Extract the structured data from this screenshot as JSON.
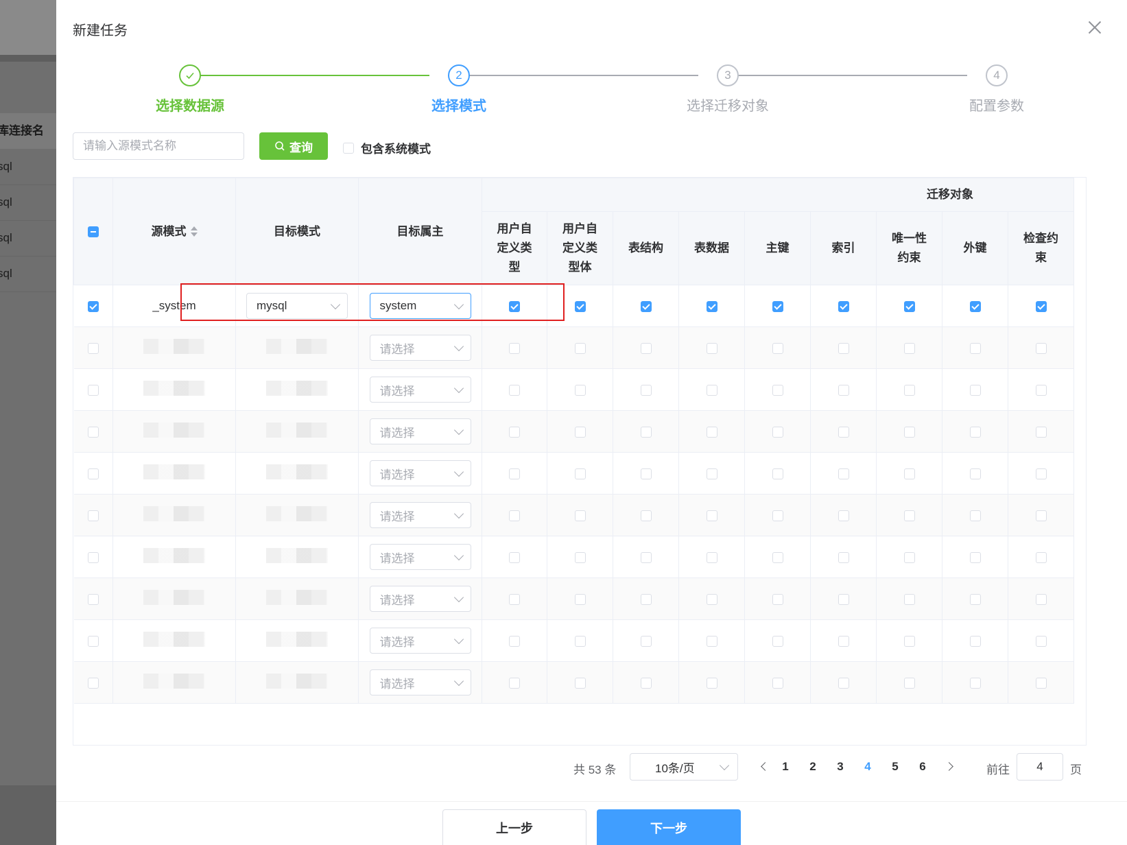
{
  "background": {
    "column_header": "库连接名",
    "rows": [
      "sql",
      "sql",
      "sql",
      "sql"
    ]
  },
  "dialog": {
    "title": "新建任务",
    "steps": [
      {
        "title": "选择数据源",
        "number": "1",
        "state": "done"
      },
      {
        "title": "选择模式",
        "number": "2",
        "state": "active"
      },
      {
        "title": "选择迁移对象",
        "number": "3",
        "state": "wait"
      },
      {
        "title": "配置参数",
        "number": "4",
        "state": "wait"
      }
    ],
    "search": {
      "placeholder": "请输入源模式名称",
      "button": "查询",
      "include_system_label": "包含系统模式"
    },
    "table": {
      "headers": {
        "source_schema": "源模式",
        "target_schema": "目标模式",
        "target_owner": "目标属主",
        "migrate_objects": "迁移对象",
        "objects": [
          "用户自定义类型",
          "用户自定义类型体",
          "表结构",
          "表数据",
          "主键",
          "索引",
          "唯一性约束",
          "外键",
          "检查约束"
        ]
      },
      "first_row": {
        "source": "_system",
        "target_schema": "mysql",
        "target_owner": "system"
      },
      "select_placeholder": "请选择",
      "placeholder_rows": 9
    },
    "pagination": {
      "total": "共 53 条",
      "page_size": "10条/页",
      "pages": [
        "1",
        "2",
        "3",
        "4",
        "5",
        "6"
      ],
      "current_page": "4",
      "goto_label": "前往",
      "goto_value": "4",
      "page_unit": "页"
    },
    "footer": {
      "prev": "上一步",
      "next": "下一步"
    }
  },
  "colors": {
    "primary": "#409eff",
    "success": "#67c23a",
    "highlight": "#e02020"
  }
}
